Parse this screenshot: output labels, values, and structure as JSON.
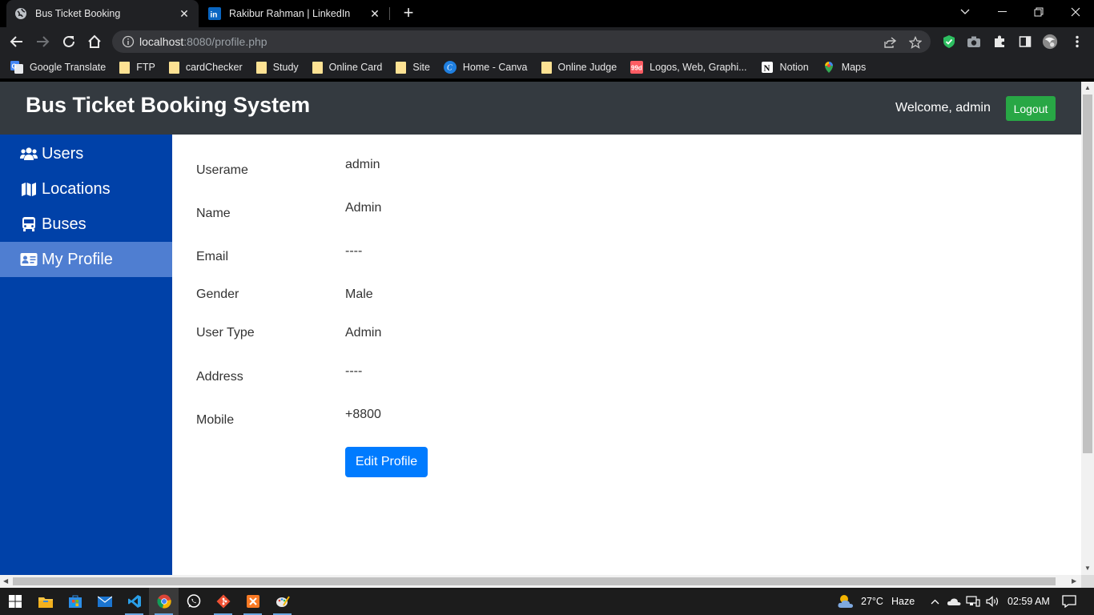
{
  "browser": {
    "tabs": [
      {
        "title": "Bus Ticket Booking",
        "active": true
      },
      {
        "title": "Rakibur Rahman | LinkedIn",
        "active": false
      }
    ],
    "url_host": "localhost",
    "url_rest": ":8080/profile.php",
    "bookmarks": [
      {
        "label": "Google Translate",
        "icon": "google-translate-icon"
      },
      {
        "label": "FTP",
        "icon": "folder-icon"
      },
      {
        "label": "cardChecker",
        "icon": "folder-icon"
      },
      {
        "label": "Study",
        "icon": "folder-icon"
      },
      {
        "label": "Online Card",
        "icon": "folder-icon"
      },
      {
        "label": "Site",
        "icon": "folder-icon"
      },
      {
        "label": "Home - Canva",
        "icon": "canva-icon"
      },
      {
        "label": "Online Judge",
        "icon": "folder-icon"
      },
      {
        "label": "Logos, Web, Graphi...",
        "icon": "99designs-icon"
      },
      {
        "label": "Notion",
        "icon": "notion-icon"
      },
      {
        "label": "Maps",
        "icon": "maps-icon"
      }
    ]
  },
  "app": {
    "title": "Bus Ticket Booking System",
    "welcome": "Welcome, admin",
    "logout_label": "Logout",
    "sidebar": [
      {
        "label": "Users",
        "icon": "users-icon"
      },
      {
        "label": "Locations",
        "icon": "map-icon"
      },
      {
        "label": "Buses",
        "icon": "bus-icon"
      },
      {
        "label": "My Profile",
        "icon": "id-card-icon",
        "active": true
      }
    ],
    "profile": {
      "fields": [
        {
          "label": "Userame",
          "value": "admin"
        },
        {
          "label": "Name",
          "value": "Admin"
        },
        {
          "label": "Email",
          "value": "----"
        },
        {
          "label": "Gender",
          "value": "Male"
        },
        {
          "label": "User Type",
          "value": "Admin"
        },
        {
          "label": "Address",
          "value": "----"
        },
        {
          "label": "Mobile",
          "value": "+8800"
        }
      ],
      "edit_label": "Edit Profile"
    }
  },
  "taskbar": {
    "weather": "27°C",
    "weather_desc": "Haze",
    "time": "02:59 AM"
  },
  "colors": {
    "header_bg": "#343a40",
    "sidebar_bg": "#0041a8",
    "sidebar_active": "#4f7ed1",
    "logout_green": "#28a745",
    "edit_blue": "#007bff"
  }
}
